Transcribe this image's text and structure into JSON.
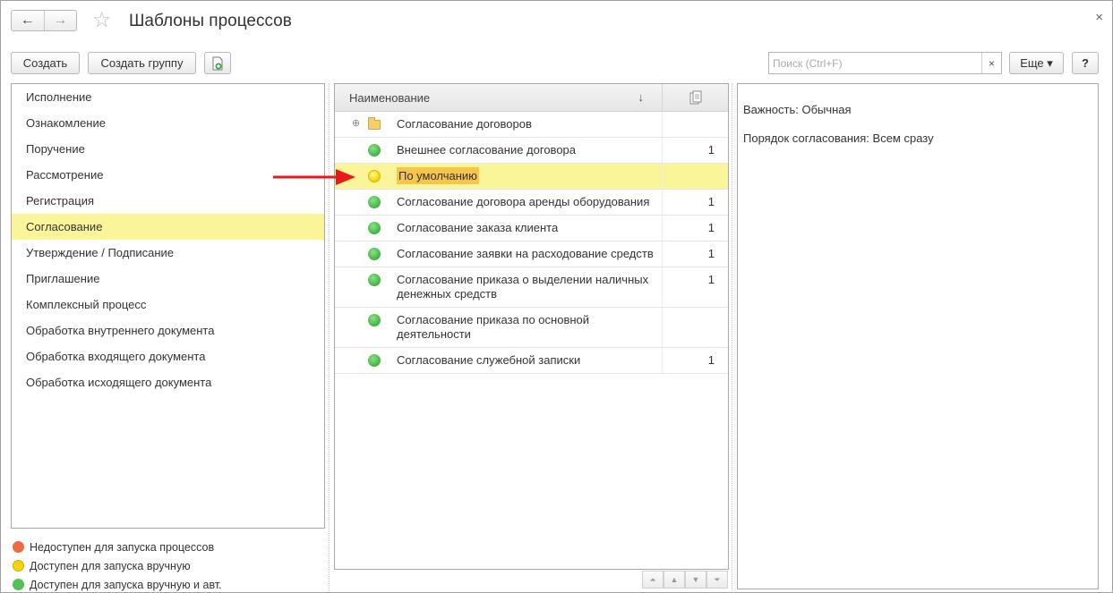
{
  "window": {
    "title": "Шаблоны процессов",
    "back_icon": "←",
    "forward_icon": "→",
    "star_icon": "☆",
    "close_icon": "×"
  },
  "toolbar": {
    "create_label": "Создать",
    "create_group_label": "Создать группу",
    "search_placeholder": "Поиск (Ctrl+F)",
    "search_clear": "×",
    "more_label": "Еще ▾",
    "help_label": "?"
  },
  "process_kinds": [
    {
      "label": "Исполнение"
    },
    {
      "label": "Ознакомление"
    },
    {
      "label": "Поручение"
    },
    {
      "label": "Рассмотрение"
    },
    {
      "label": "Регистрация"
    },
    {
      "label": "Согласование",
      "selected": true
    },
    {
      "label": "Утверждение / Подписание"
    },
    {
      "label": "Приглашение"
    },
    {
      "label": "Комплексный процесс"
    },
    {
      "label": "Обработка внутреннего документа"
    },
    {
      "label": "Обработка входящего документа"
    },
    {
      "label": "Обработка исходящего документа"
    }
  ],
  "legend": [
    {
      "label": "Недоступен для запуска процессов",
      "color": "#ee6a43"
    },
    {
      "label": "Доступен для запуска вручную",
      "color": "#f2d500"
    },
    {
      "label": "Доступен для запуска вручную и авт.",
      "color": "#55c155"
    }
  ],
  "table": {
    "header_name": "Наименование",
    "sort_icon": "↓",
    "rows": [
      {
        "name": "Согласование договоров",
        "count": "",
        "icon": "folder"
      },
      {
        "name": "Внешнее согласование договора",
        "count": "1",
        "icon": "green"
      },
      {
        "name": "По умолчанию",
        "count": "",
        "icon": "yellow",
        "selected": true
      },
      {
        "name": "Согласование договора аренды оборудования",
        "count": "1",
        "icon": "green"
      },
      {
        "name": "Согласование заказа клиента",
        "count": "1",
        "icon": "green"
      },
      {
        "name": "Согласование заявки на расходование средств",
        "count": "1",
        "icon": "green"
      },
      {
        "name": "Согласование приказа о выделении наличных денежных средств",
        "count": "1",
        "icon": "green"
      },
      {
        "name": "Согласование приказа по основной деятельности",
        "count": "",
        "icon": "green"
      },
      {
        "name": "Согласование служебной записки",
        "count": "1",
        "icon": "green"
      }
    ]
  },
  "details": {
    "importance": "Важность: Обычная",
    "order": "Порядок согласования: Всем сразу"
  }
}
